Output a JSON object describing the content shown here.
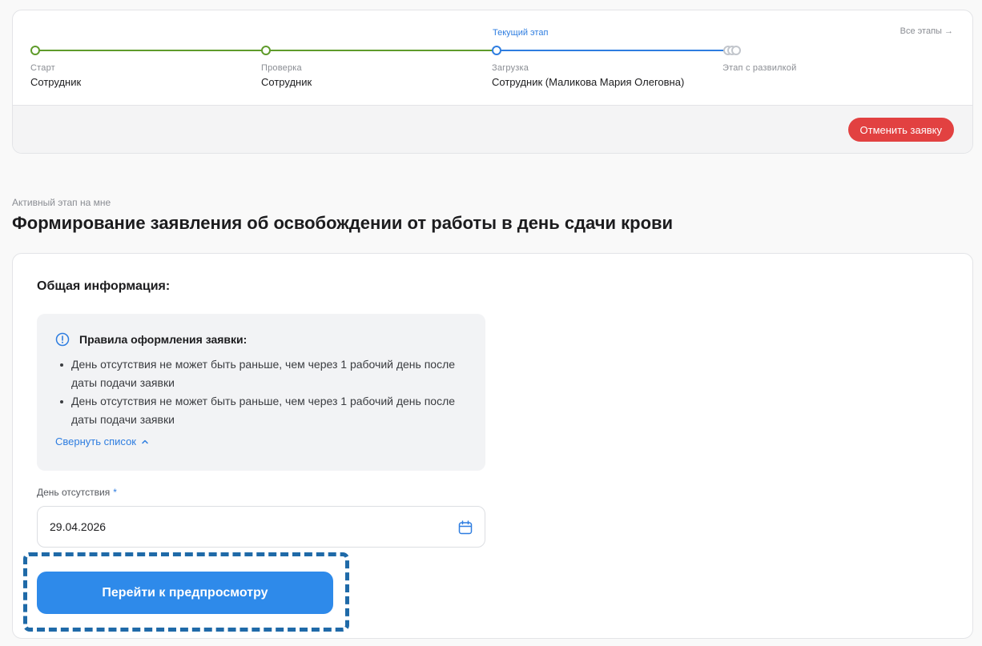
{
  "stages": {
    "current_tag": "Текущий этап",
    "all_stages_label": "Все этапы →",
    "steps": [
      {
        "label": "Старт",
        "value": "Сотрудник",
        "status": "done"
      },
      {
        "label": "Проверка",
        "value": "Сотрудник",
        "status": "done"
      },
      {
        "label": "Загрузка",
        "value": "Сотрудник (Маликова Мария Олеговна)",
        "status": "current"
      },
      {
        "label": "Этап с развилкой",
        "value": "",
        "status": "fork"
      }
    ],
    "cancel_label": "Отменить заявку"
  },
  "header": {
    "subtitle": "Активный этап на мне",
    "title": "Формирование заявления об освобождении от работы в день сдачи крови"
  },
  "form": {
    "section_title": "Общая информация:",
    "rules": {
      "title": "Правила оформления заявки:",
      "items": [
        "День отсутствия не может быть раньше, чем через 1 рабочий день после даты подачи заявки",
        "День отсутствия не может быть раньше, чем через 1 рабочий день после даты подачи заявки"
      ],
      "collapse_label": "Свернуть список"
    },
    "absence_day": {
      "label": "День отсутствия",
      "required_mark": "*",
      "value": "29.04.2026"
    },
    "preview_button": "Перейти к предпросмотру"
  },
  "colors": {
    "green": "#5f9b2b",
    "blue": "#2e7de0",
    "danger": "#e24141",
    "primary_button": "#2e8aea",
    "focus_frame": "#1f6aa8"
  },
  "icons": [
    "info-icon",
    "chevron-up-icon",
    "calendar-icon",
    "arrow-right-icon"
  ]
}
